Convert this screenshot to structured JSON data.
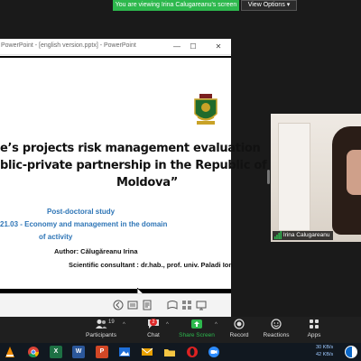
{
  "share_banner": {
    "text": "You are viewing Irina Calugareanu's screen",
    "color": "#2db84d"
  },
  "view_options": {
    "label": "View Options ▾"
  },
  "ppt": {
    "window_title": "PowerPoint - [english version.pptx] - PowerPoint",
    "controls": {
      "minimize": "—",
      "maximize": "☐",
      "close": "✕"
    },
    "slide": {
      "title_line1": "e’s projects risk management evaluation",
      "title_line2": "blic-private partnership in the Republic of",
      "title_line3": "Moldova”",
      "subtitle_line1": "Post-doctoral study",
      "subtitle_line2": "21.03 - Economy and management in the domain",
      "subtitle_line3": "of activity",
      "author_line": "Author:  Călugăreanu Irina",
      "consultant_line": "Scientific consultant : dr.hab., prof. univ. Paladi Ion",
      "accent_color": "#2e75b6"
    },
    "status_icons": [
      "prev-icon",
      "slide-sorter-icon",
      "notes-icon",
      "reading-view-icon",
      "grid-icon",
      "slideshow-icon"
    ]
  },
  "participant": {
    "name": "Irina Calugareanu"
  },
  "toolbar": {
    "participants": {
      "label": "Participants",
      "count": "19"
    },
    "chat": {
      "label": "Chat",
      "badge": "2"
    },
    "share": {
      "label": "Share Screen"
    },
    "record": {
      "label": "Record"
    },
    "reactions": {
      "label": "Reactions"
    },
    "apps": {
      "label": "Apps"
    }
  },
  "taskbar": {
    "apps": [
      "vlc-icon",
      "chrome-icon",
      "excel-icon",
      "word-icon",
      "powerpoint-icon",
      "photos-icon",
      "mail-icon",
      "folder-icon",
      "opera-icon",
      "zoom-icon"
    ],
    "net_up": "30 KB/s",
    "net_down": "42 KB/s"
  }
}
